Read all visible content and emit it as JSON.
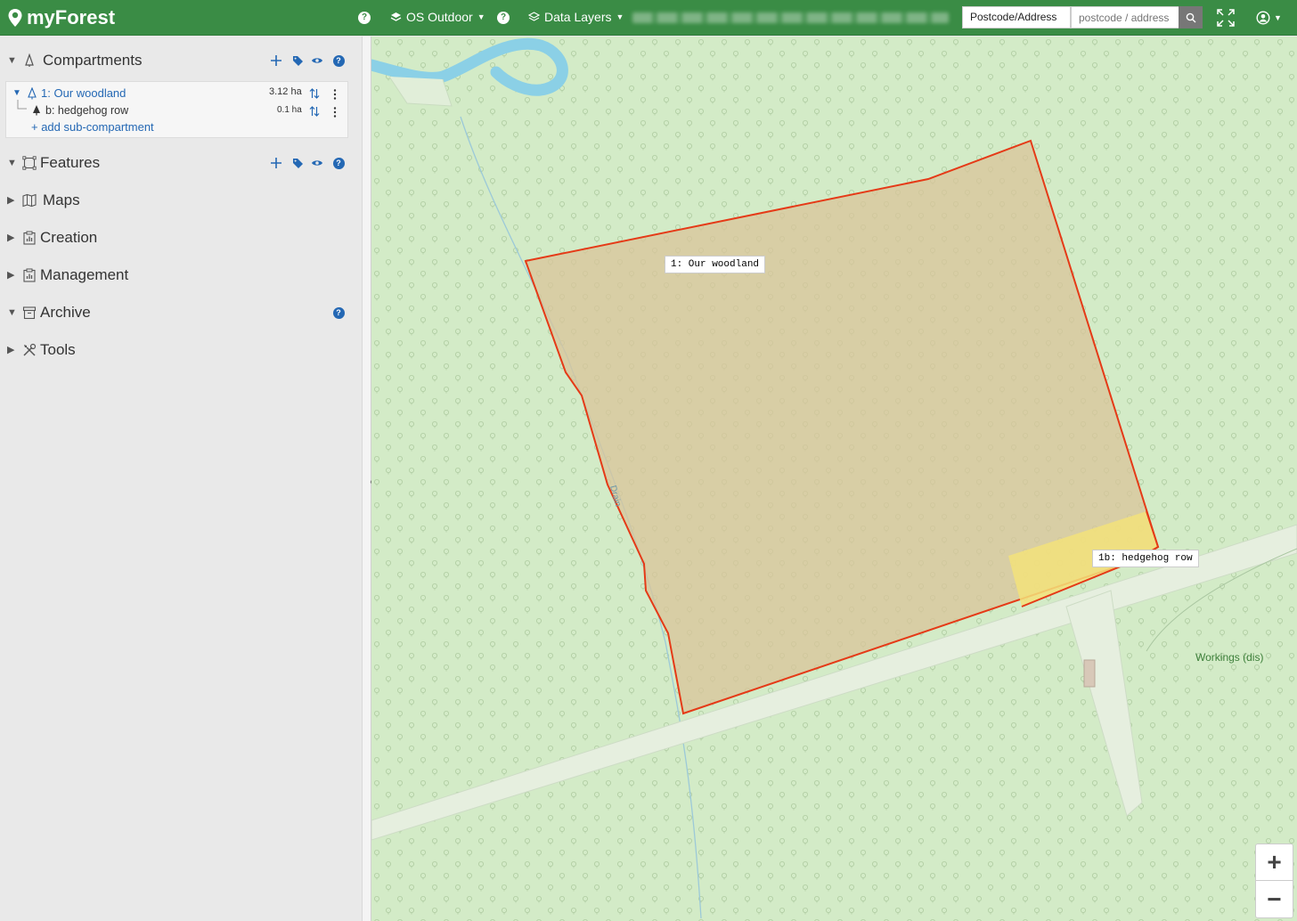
{
  "app": {
    "name": "myForest",
    "brand_color": "#3a8c45",
    "accent_color": "#2468b4"
  },
  "header": {
    "help_icon": "help-circle-icon",
    "basemap_label": "OS Outdoor",
    "data_layers_label": "Data Layers",
    "search_type": "Postcode/Address",
    "search_placeholder": "postcode / address",
    "search_icon": "search-icon",
    "fullscreen_icon": "fullscreen-icon",
    "user_icon": "user-circle-icon"
  },
  "sidebar": {
    "compartments": {
      "label": "Compartments",
      "expanded": true,
      "items": [
        {
          "label": "1: Our woodland",
          "area": "3.12 ha",
          "icon": "tree-outline-icon"
        },
        {
          "label": "b: hedgehog row",
          "area": "0.1 ha",
          "icon": "tree-filled-icon"
        }
      ],
      "add_sub_label": "+ add sub-compartment"
    },
    "features": {
      "label": "Features",
      "expanded": true
    },
    "maps": {
      "label": "Maps",
      "expanded": false
    },
    "creation": {
      "label": "Creation",
      "expanded": false
    },
    "management": {
      "label": "Management",
      "expanded": false
    },
    "archive": {
      "label": "Archive",
      "expanded": true
    },
    "tools": {
      "label": "Tools",
      "expanded": false
    }
  },
  "map": {
    "labels": {
      "woodland": "1: Our woodland",
      "hedgehog": "1b: hedgehog row"
    },
    "stream_label": "Drain",
    "poi_label": "Workings (dis)",
    "compartment_stroke": "#e53a17",
    "compartment_fill": "#d9c49a",
    "subcompartment_fill": "#f3e27a",
    "zoom_in": "+",
    "zoom_out": "−"
  }
}
